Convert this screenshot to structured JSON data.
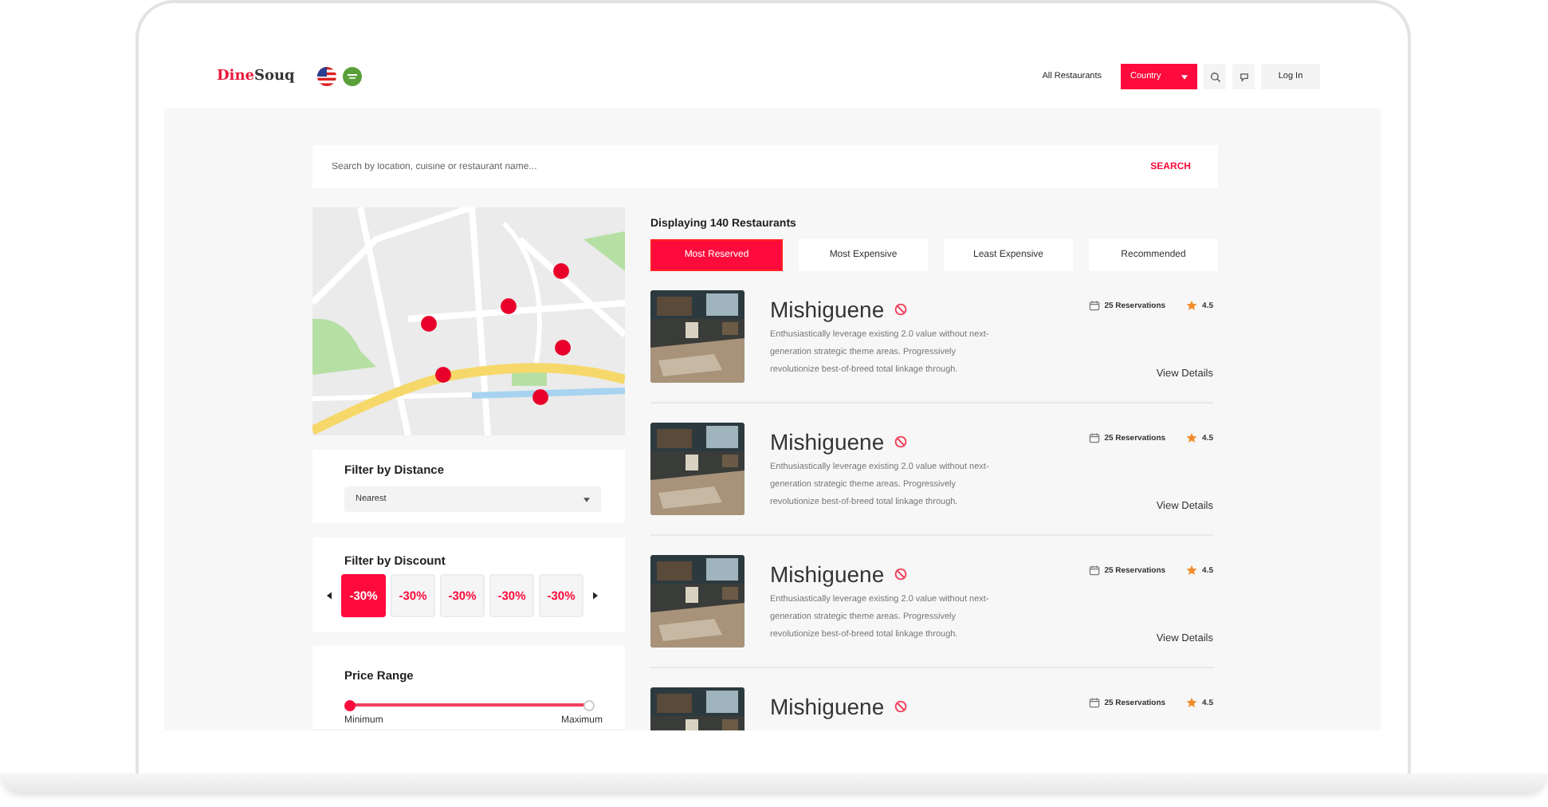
{
  "header": {
    "logo": {
      "part1": "Dine",
      "part2": "Souq"
    },
    "nav_link": "All Restaurants",
    "country_button": "Country",
    "login_button": "Log In"
  },
  "search": {
    "placeholder": "Search by location, cuisine or restaurant name...",
    "button": "SEARCH"
  },
  "distance_filter": {
    "title": "Filter by Distance",
    "value": "Nearest"
  },
  "discount_filter": {
    "title": "Filter by Discount",
    "tiles": [
      {
        "label": "-30%",
        "selected": true
      },
      {
        "label": "-30%",
        "selected": false
      },
      {
        "label": "-30%",
        "selected": false
      },
      {
        "label": "-30%",
        "selected": false
      },
      {
        "label": "-30%",
        "selected": false
      }
    ]
  },
  "price_range": {
    "title": "Price Range",
    "level": 1,
    "min_label": "Minimum",
    "max_label": "Maximum"
  },
  "results": {
    "count_text": "Displaying 140 Restaurants",
    "sort_tabs": [
      {
        "label": "Most Reserved",
        "selected": true
      },
      {
        "label": "Most Expensive",
        "selected": false
      },
      {
        "label": "Least Expensive",
        "selected": false
      },
      {
        "label": "Recommended",
        "selected": false
      }
    ],
    "restaurants": [
      {
        "name": "Mishiguene",
        "reservations": "25 Reservations",
        "rating": "4.5",
        "description": "Enthusiastically leverage existing 2.0 value without next-generation strategic theme areas. Progressively revolutionize best-of-breed total linkage through.",
        "action": "View Details"
      },
      {
        "name": "Mishiguene",
        "reservations": "25 Reservations",
        "rating": "4.5",
        "description": "Enthusiastically leverage existing 2.0 value without next-generation strategic theme areas. Progressively revolutionize best-of-breed total linkage through.",
        "action": "View Details"
      },
      {
        "name": "Mishiguene",
        "reservations": "25 Reservations",
        "rating": "4.5",
        "description": "Enthusiastically leverage existing 2.0 value without next-generation strategic theme areas. Progressively revolutionize best-of-breed total linkage through.",
        "action": "View Details"
      },
      {
        "name": "Mishiguene",
        "reservations": "25 Reservations",
        "rating": "4.5"
      }
    ]
  }
}
